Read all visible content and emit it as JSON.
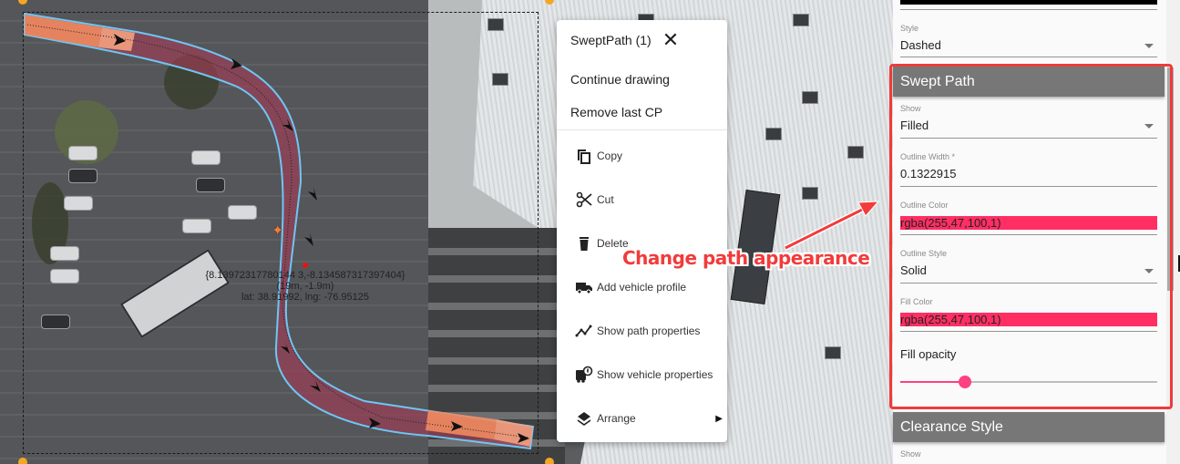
{
  "map": {
    "coordinate_readout": {
      "vector": "{8.13972317780144 3,-8.134587317397404}",
      "size": "(19m, -1.9m)",
      "latlng": "lat: 38.91992, lng: -76.95125"
    },
    "path_colors": {
      "fill": "#a04a5c",
      "outline": "#6ec6f5",
      "vehicle": "#f08a60"
    }
  },
  "context_menu": {
    "title": "SweptPath (1)",
    "close_icon": "close-icon",
    "top_actions": [
      {
        "label": "Continue drawing"
      },
      {
        "label": "Remove last CP"
      }
    ],
    "items": [
      {
        "label": "Copy",
        "icon": "copy-icon"
      },
      {
        "label": "Cut",
        "icon": "scissors-icon"
      },
      {
        "label": "Delete",
        "icon": "trash-icon"
      },
      {
        "label": "Add vehicle profile",
        "icon": "truck-icon"
      },
      {
        "label": "Show path properties",
        "icon": "path-icon"
      },
      {
        "label": "Show vehicle properties",
        "icon": "vehicle-info-icon"
      },
      {
        "label": "Arrange",
        "icon": "layers-icon",
        "submenu": true
      }
    ]
  },
  "annotation": {
    "text": "Change path appearance",
    "color": "#f23b3b"
  },
  "panel": {
    "top_color_value": "rgba(0,0,0,1)",
    "style_field": {
      "label": "Style",
      "value": "Dashed"
    },
    "swept_path": {
      "title": "Swept Path",
      "show": {
        "label": "Show",
        "value": "Filled"
      },
      "outline_width": {
        "label": "Outline Width *",
        "value": "0.1322915"
      },
      "outline_color": {
        "label": "Outline Color",
        "value": "rgba(255,47,100,1)",
        "swatch": "#ff2f64"
      },
      "outline_style": {
        "label": "Outline Style",
        "value": "Solid"
      },
      "fill_color": {
        "label": "Fill Color",
        "value": "rgba(255,47,100,1)",
        "swatch": "#ff2f64"
      },
      "fill_opacity": {
        "label": "Fill opacity",
        "value": 0.25
      }
    },
    "clearance_style": {
      "title": "Clearance Style",
      "show": {
        "label": "Show"
      }
    }
  }
}
